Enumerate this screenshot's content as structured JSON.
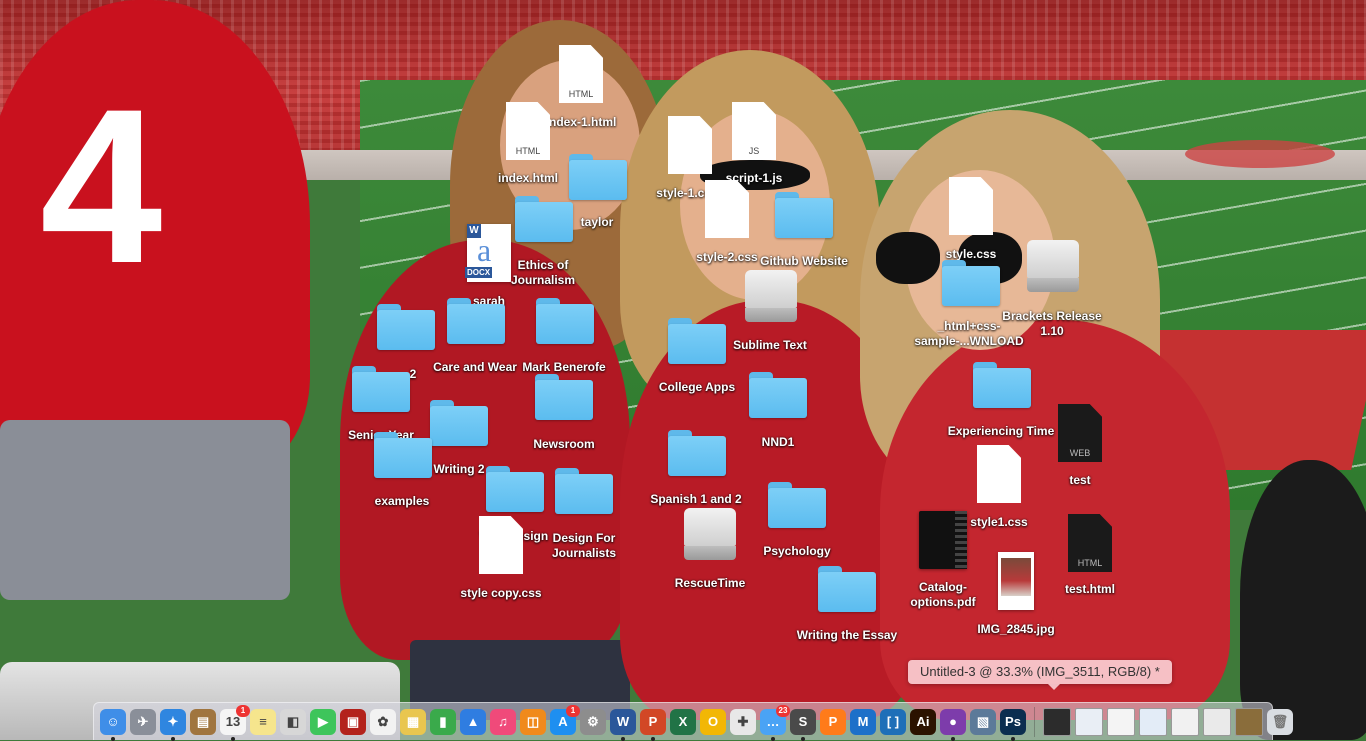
{
  "desktop": {
    "icons": [
      {
        "id": "index-1-html",
        "label": "index-1.html",
        "kind": "doc",
        "ext": "HTML"
      },
      {
        "id": "index-html",
        "label": "index.html",
        "kind": "doc",
        "ext": "HTML"
      },
      {
        "id": "taylor",
        "label": "taylor",
        "kind": "folder"
      },
      {
        "id": "ethics-of-journalism",
        "label": "Ethics of\nJournalism",
        "kind": "docx",
        "ext": "DOCX"
      },
      {
        "id": "sarah",
        "label": "sarah",
        "kind": "folder"
      },
      {
        "id": "style-1-css",
        "label": "style-1.css",
        "kind": "doc",
        "ext": ""
      },
      {
        "id": "script-1-js",
        "label": "script-1.js",
        "kind": "doc",
        "ext": "JS"
      },
      {
        "id": "style-2-css",
        "label": "style-2.css",
        "kind": "doc",
        "ext": ""
      },
      {
        "id": "github-website",
        "label": "Github Website",
        "kind": "folder"
      },
      {
        "id": "style-css",
        "label": "style.css",
        "kind": "doc",
        "ext": ""
      },
      {
        "id": "html-css-download",
        "label": "_html+css-\nsample-...WNLOAD",
        "kind": "folder"
      },
      {
        "id": "brackets-release",
        "label": "Brackets Release\n1.10",
        "kind": "disk"
      },
      {
        "id": "folder-2",
        "label": "2",
        "kind": "folder"
      },
      {
        "id": "care-and-wear",
        "label": "Care and Wear",
        "kind": "folder"
      },
      {
        "id": "mark-benerofe",
        "label": "Mark Benerofe",
        "kind": "folder"
      },
      {
        "id": "sublime-text",
        "label": "Sublime Text",
        "kind": "disk"
      },
      {
        "id": "college-apps",
        "label": "College Apps",
        "kind": "folder"
      },
      {
        "id": "senior-year",
        "label": "Senior Year",
        "kind": "folder"
      },
      {
        "id": "writing-2",
        "label": "Writing 2",
        "kind": "folder"
      },
      {
        "id": "newsroom",
        "label": "Newsroom",
        "kind": "folder"
      },
      {
        "id": "nnd1",
        "label": "NND1",
        "kind": "folder"
      },
      {
        "id": "experiencing-time",
        "label": "Experiencing Time",
        "kind": "folder"
      },
      {
        "id": "test",
        "label": "test",
        "kind": "docdark",
        "ext": "WEB"
      },
      {
        "id": "examples",
        "label": "examples",
        "kind": "folder"
      },
      {
        "id": "web-design",
        "label": "Web Design",
        "kind": "folder"
      },
      {
        "id": "design-for-journalists",
        "label": "Design For\nJournalists",
        "kind": "folder"
      },
      {
        "id": "spanish-1-and-2",
        "label": "Spanish 1 and 2",
        "kind": "folder"
      },
      {
        "id": "style1-css",
        "label": "style1.css",
        "kind": "doc",
        "ext": ""
      },
      {
        "id": "style-copy-css",
        "label": "style copy.css",
        "kind": "doc",
        "ext": ""
      },
      {
        "id": "rescuetime",
        "label": "RescueTime",
        "kind": "disk"
      },
      {
        "id": "psychology",
        "label": "Psychology",
        "kind": "folder"
      },
      {
        "id": "catalog-options-pdf",
        "label": "Catalog-\noptions.pdf",
        "kind": "pdf"
      },
      {
        "id": "test-html",
        "label": "test.html",
        "kind": "docdark",
        "ext": "HTML"
      },
      {
        "id": "img-2845-jpg",
        "label": "IMG_2845.jpg",
        "kind": "jpg"
      },
      {
        "id": "writing-the-essay",
        "label": "Writing the Essay",
        "kind": "folder"
      }
    ]
  },
  "tooltip": {
    "text": "Untitled-3 @ 33.3% (IMG_3511, RGB/8) *"
  },
  "dock": {
    "apps": [
      {
        "id": "finder",
        "icon": "finder-icon",
        "color": "#3f8ee8",
        "glyph": "☺",
        "running": true
      },
      {
        "id": "launchpad",
        "icon": "rocket-icon",
        "color": "#8a8f99",
        "glyph": "✈",
        "running": false
      },
      {
        "id": "safari",
        "icon": "compass-icon",
        "color": "#2f86e0",
        "glyph": "✦",
        "running": true
      },
      {
        "id": "notebook",
        "icon": "notebook-icon",
        "color": "#a0753f",
        "glyph": "▤",
        "running": false
      },
      {
        "id": "calendar",
        "icon": "calendar-icon",
        "color": "#f5f5f5",
        "glyph": "13",
        "running": true,
        "badge": "1"
      },
      {
        "id": "notes",
        "icon": "notes-icon",
        "color": "#f6e58d",
        "glyph": "≡",
        "running": false
      },
      {
        "id": "preview",
        "icon": "preview-icon",
        "color": "#d7d7d7",
        "glyph": "◧",
        "running": false
      },
      {
        "id": "facetime",
        "icon": "video-icon",
        "color": "#3ec55b",
        "glyph": "▶",
        "running": false
      },
      {
        "id": "photo-booth",
        "icon": "photo-booth-icon",
        "color": "#b3221c",
        "glyph": "▣",
        "running": false
      },
      {
        "id": "photos",
        "icon": "photos-icon",
        "color": "#f2f2f2",
        "glyph": "✿",
        "running": false
      },
      {
        "id": "stickies",
        "icon": "stickies-icon",
        "color": "#e9c64f",
        "glyph": "▦",
        "running": false
      },
      {
        "id": "numbers",
        "icon": "chart-icon",
        "color": "#3aaa4b",
        "glyph": "▮",
        "running": false
      },
      {
        "id": "keynote",
        "icon": "podium-icon",
        "color": "#2f7de1",
        "glyph": "▲",
        "running": false
      },
      {
        "id": "itunes",
        "icon": "music-icon",
        "color": "#f04a7a",
        "glyph": "♫",
        "running": false
      },
      {
        "id": "ibooks",
        "icon": "book-icon",
        "color": "#f08a1c",
        "glyph": "◫",
        "running": false
      },
      {
        "id": "app-store",
        "icon": "app-store-icon",
        "color": "#1e8ff0",
        "glyph": "A",
        "running": false,
        "badge": "1"
      },
      {
        "id": "system-preferences",
        "icon": "gear-icon",
        "color": "#8d8d8d",
        "glyph": "⚙",
        "running": false
      },
      {
        "id": "word",
        "icon": "word-icon",
        "color": "#2b579a",
        "glyph": "W",
        "running": true
      },
      {
        "id": "powerpoint",
        "icon": "powerpoint-icon",
        "color": "#d24726",
        "glyph": "P",
        "running": true
      },
      {
        "id": "excel",
        "icon": "excel-icon",
        "color": "#217346",
        "glyph": "X",
        "running": false
      },
      {
        "id": "outlook-like",
        "icon": "ring-icon",
        "color": "#f2b705",
        "glyph": "O",
        "running": false
      },
      {
        "id": "first-aid",
        "icon": "cross-icon",
        "color": "#e8e8e8",
        "glyph": "✚",
        "running": false
      },
      {
        "id": "messages",
        "icon": "chat-icon",
        "color": "#4aa3f5",
        "glyph": "…",
        "running": true,
        "badge": "23"
      },
      {
        "id": "sublime",
        "icon": "sublime-icon",
        "color": "#4a4a4a",
        "glyph": "S",
        "running": true
      },
      {
        "id": "pages-like",
        "icon": "p-icon",
        "color": "#ff7b1a",
        "glyph": "P",
        "running": false
      },
      {
        "id": "mendeley",
        "icon": "m-icon",
        "color": "#1d70c9",
        "glyph": "M",
        "running": false
      },
      {
        "id": "brackets",
        "icon": "brackets-icon",
        "color": "#1e6fb8",
        "glyph": "[ ]",
        "running": false
      },
      {
        "id": "illustrator",
        "icon": "illustrator-icon",
        "color": "#2b1200",
        "glyph": "Ai",
        "running": false
      },
      {
        "id": "github-desktop",
        "icon": "github-icon",
        "color": "#7d3cab",
        "glyph": "●",
        "running": true
      },
      {
        "id": "image-capture",
        "icon": "image-icon",
        "color": "#5c7a99",
        "glyph": "▧",
        "running": false
      },
      {
        "id": "photoshop",
        "icon": "photoshop-icon",
        "color": "#0b2d4f",
        "glyph": "Ps",
        "running": true
      }
    ],
    "minimized": [
      {
        "id": "min-1",
        "icon": "terminal-window-icon",
        "color": "#2c2c2c"
      },
      {
        "id": "min-2",
        "icon": "window-thumbnail-icon",
        "color": "#e9eef5"
      },
      {
        "id": "min-3",
        "icon": "window-thumbnail-icon",
        "color": "#f4f4f4"
      },
      {
        "id": "min-4",
        "icon": "window-thumbnail-icon",
        "color": "#e3ecf7"
      },
      {
        "id": "min-5",
        "icon": "window-thumbnail-icon",
        "color": "#f1f1f1"
      },
      {
        "id": "min-6",
        "icon": "window-thumbnail-icon",
        "color": "#eaeaea"
      },
      {
        "id": "min-7",
        "icon": "photo-thumbnail-icon",
        "color": "#8a6d3b"
      }
    ],
    "trash": {
      "icon": "trash-icon",
      "color": "#d9dde2"
    }
  }
}
